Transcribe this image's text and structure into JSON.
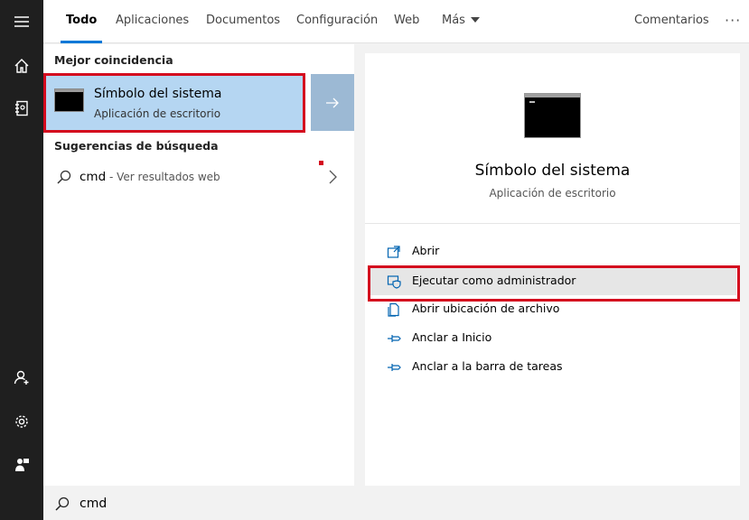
{
  "rail": {
    "icons": [
      "hamburger-menu-icon",
      "home-icon",
      "notebook-icon",
      "account-icon",
      "settings-gear-icon",
      "feedback-person-icon"
    ]
  },
  "tabs": {
    "items": [
      {
        "label": "Todo",
        "active": true
      },
      {
        "label": "Aplicaciones",
        "active": false
      },
      {
        "label": "Documentos",
        "active": false
      },
      {
        "label": "Configuración",
        "active": false
      },
      {
        "label": "Web",
        "active": false
      },
      {
        "label": "Más",
        "active": false
      }
    ],
    "feedback_label": "Comentarios",
    "more_options": "···"
  },
  "results": {
    "best_match_heading": "Mejor coincidencia",
    "best_match": {
      "title": "Símbolo del sistema",
      "subtitle": "Aplicación de escritorio",
      "icon": "command-prompt-icon"
    },
    "suggestions_heading": "Sugerencias de búsqueda",
    "suggestion": {
      "query": "cmd",
      "hint": " - Ver resultados web"
    }
  },
  "preview": {
    "title": "Símbolo del sistema",
    "subtitle": "Aplicación de escritorio",
    "actions": [
      {
        "label": "Abrir",
        "icon": "open-window-icon"
      },
      {
        "label": "Ejecutar como administrador",
        "icon": "shield-admin-icon",
        "highlighted": true
      },
      {
        "label": "Abrir ubicación de archivo",
        "icon": "file-location-icon"
      },
      {
        "label": "Anclar a Inicio",
        "icon": "pin-icon"
      },
      {
        "label": "Anclar a la barra de tareas",
        "icon": "pin-icon"
      }
    ]
  },
  "search": {
    "value": "cmd"
  },
  "colors": {
    "accent": "#0078d7",
    "highlight_red": "#d40a1e",
    "selection": "#b5d6f2",
    "rail": "#1f1f1f"
  }
}
